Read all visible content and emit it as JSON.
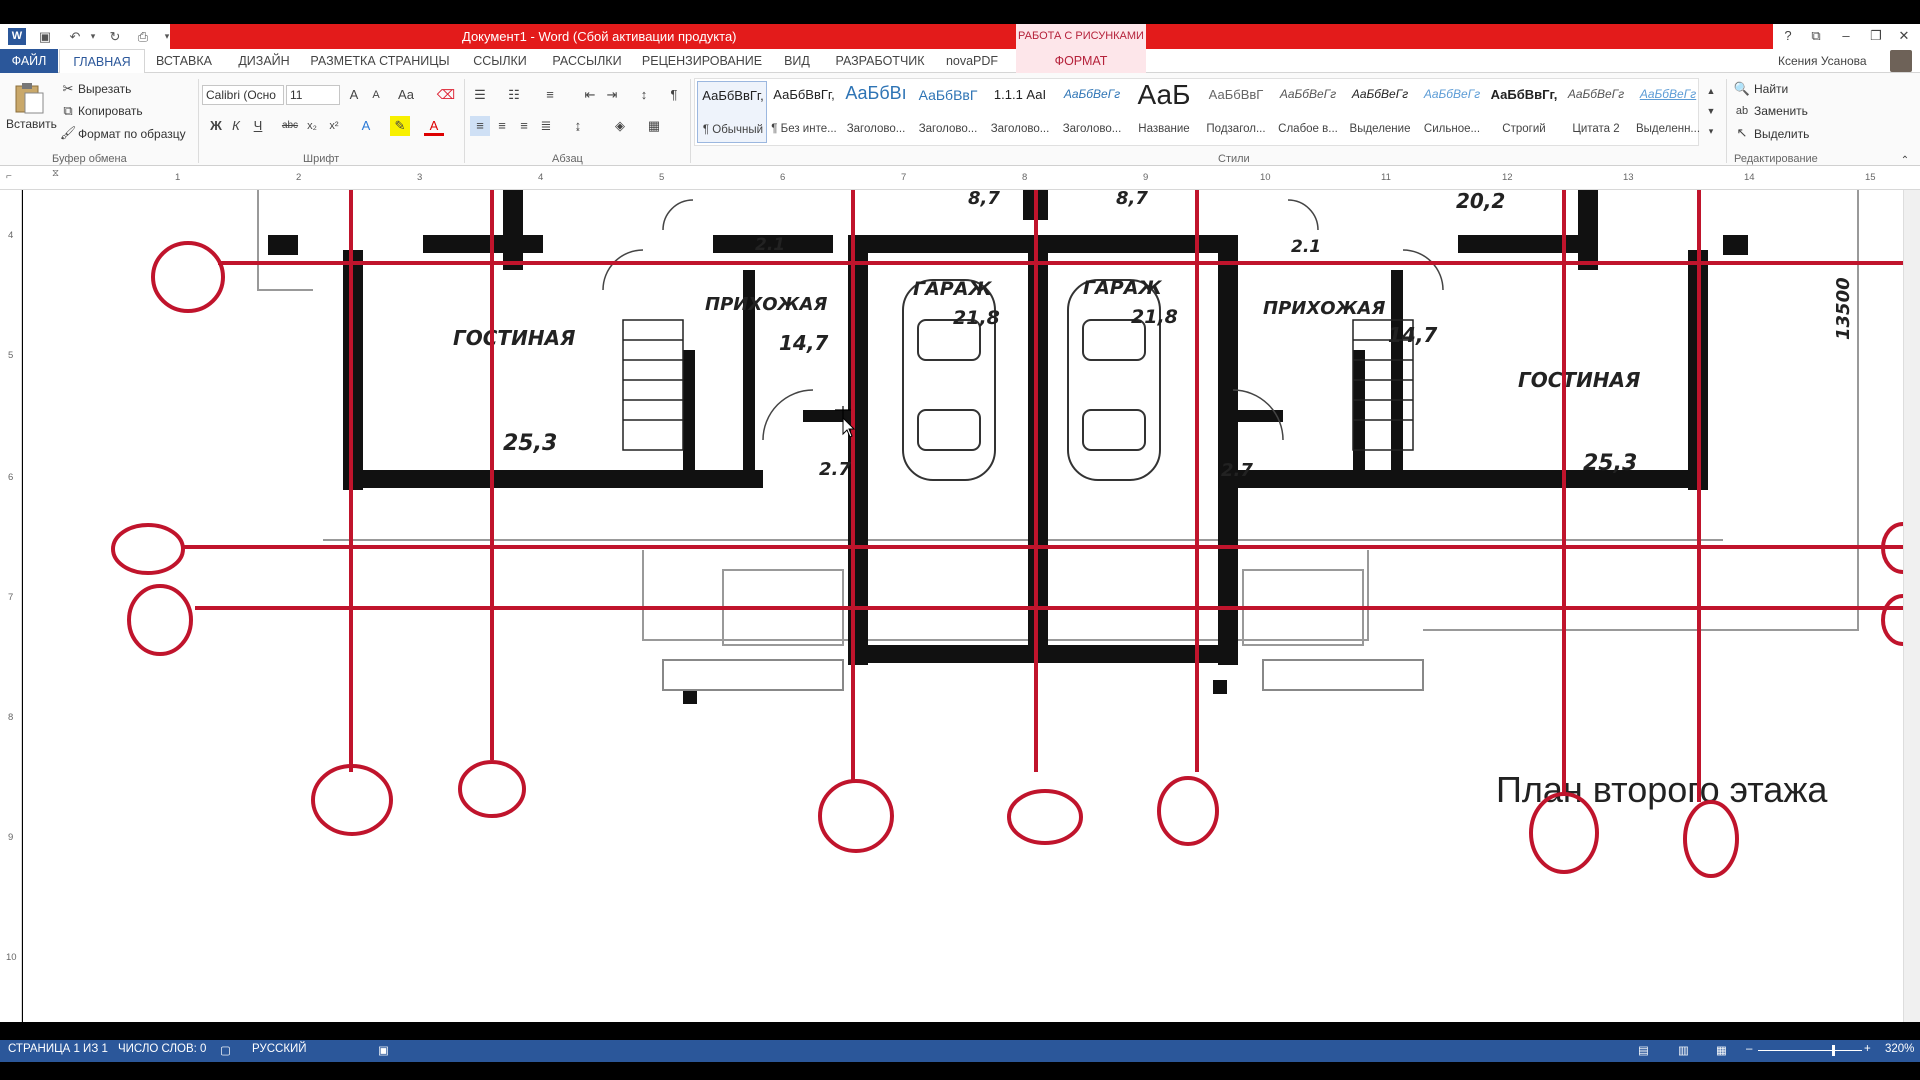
{
  "window": {
    "title": "Документ1 -  Word (Сбой активации продукта)",
    "context_tab_group": "РАБОТА С РИСУНКАМИ"
  },
  "tabs": {
    "file": "ФАЙЛ",
    "home": "ГЛАВНАЯ",
    "insert": "ВСТАВКА",
    "design": "ДИЗАЙН",
    "layout": "РАЗМЕТКА СТРАНИЦЫ",
    "references": "ССЫЛКИ",
    "mailings": "РАССЫЛКИ",
    "review": "РЕЦЕНЗИРОВАНИЕ",
    "view": "ВИД",
    "developer": "РАЗРАБОТЧИК",
    "novapdf": "novaPDF",
    "format": "ФОРМАТ"
  },
  "user": {
    "name": "Ксения Усанова"
  },
  "clipboard": {
    "paste": "Вставить",
    "cut": "Вырезать",
    "copy": "Копировать",
    "format_painter": "Формат по образцу",
    "label": "Буфер обмена"
  },
  "font": {
    "name": "Calibri (Осно",
    "size": "11",
    "bold": "Ж",
    "italic": "К",
    "underline": "Ч",
    "strike": "abc",
    "subscript": "x₂",
    "superscript": "x²",
    "label": "Шрифт"
  },
  "paragraph": {
    "label": "Абзац"
  },
  "styles": {
    "label": "Стили",
    "items": [
      {
        "sample": "АаБбВвГг,",
        "name": "¶ Обычный"
      },
      {
        "sample": "АаБбВвГг,",
        "name": "¶ Без инте..."
      },
      {
        "sample": "АаБбВı",
        "name": "Заголово..."
      },
      {
        "sample": "АаБбВвГ",
        "name": "Заголово..."
      },
      {
        "sample": "1.1.1  АаI",
        "name": "Заголово..."
      },
      {
        "sample": "АаБбВеГг",
        "name": "Заголово..."
      },
      {
        "sample": "АаБ",
        "name": "Название"
      },
      {
        "sample": "АаБбВвГ",
        "name": "Подзагол..."
      },
      {
        "sample": "АаБбВеГг",
        "name": "Слабое в..."
      },
      {
        "sample": "АаБбВеГг",
        "name": "Выделение"
      },
      {
        "sample": "АаБбВеГг",
        "name": "Сильное..."
      },
      {
        "sample": "АаБбВвГг,",
        "name": "Строгий"
      },
      {
        "sample": "АаБбВеГг",
        "name": "Цитата 2"
      },
      {
        "sample": "АаБбВеГг",
        "name": "Выделенн..."
      }
    ]
  },
  "editing": {
    "find": "Найти",
    "replace": "Заменить",
    "select": "Выделить",
    "label": "Редактирование"
  },
  "ruler": {
    "h_numbers": [
      "1",
      "2",
      "3",
      "4",
      "5",
      "6",
      "7",
      "8",
      "9",
      "10",
      "11",
      "12",
      "13",
      "14",
      "15"
    ],
    "v_numbers": [
      "4",
      "5",
      "6",
      "7",
      "8",
      "9",
      "10"
    ]
  },
  "plan": {
    "rooms": {
      "living_left": "ГОСТИНАЯ",
      "living_left_area": "25,3",
      "hall_left": "ПРИХОЖАЯ",
      "hall_left_area": "14,7",
      "wc_left": "2.1",
      "small_left": "2.7",
      "garage_left": "ГАРАЖ",
      "garage_left_area": "21,8",
      "garage_right": "ГАРАЖ",
      "garage_right_area": "21,8",
      "hall_right": "ПРИХОЖАЯ",
      "hall_right_area": "14,7",
      "wc_right": "2.1",
      "small_right": "2.7",
      "living_right": "ГОСТИНАЯ",
      "living_right_area": "25,3",
      "top_area_1": "8,7",
      "top_area_2": "8,7",
      "top_area_3": "20,2",
      "dimension": "13500"
    },
    "caption": "План второго этажа"
  },
  "status": {
    "page": "СТРАНИЦА 1 ИЗ 1",
    "words": "ЧИСЛО СЛОВ: 0",
    "language": "РУССКИЙ",
    "zoom": "320%"
  },
  "colors": {
    "accent": "#2b579a",
    "title_red": "#e31b1b",
    "axis_red": "#c0142c"
  }
}
